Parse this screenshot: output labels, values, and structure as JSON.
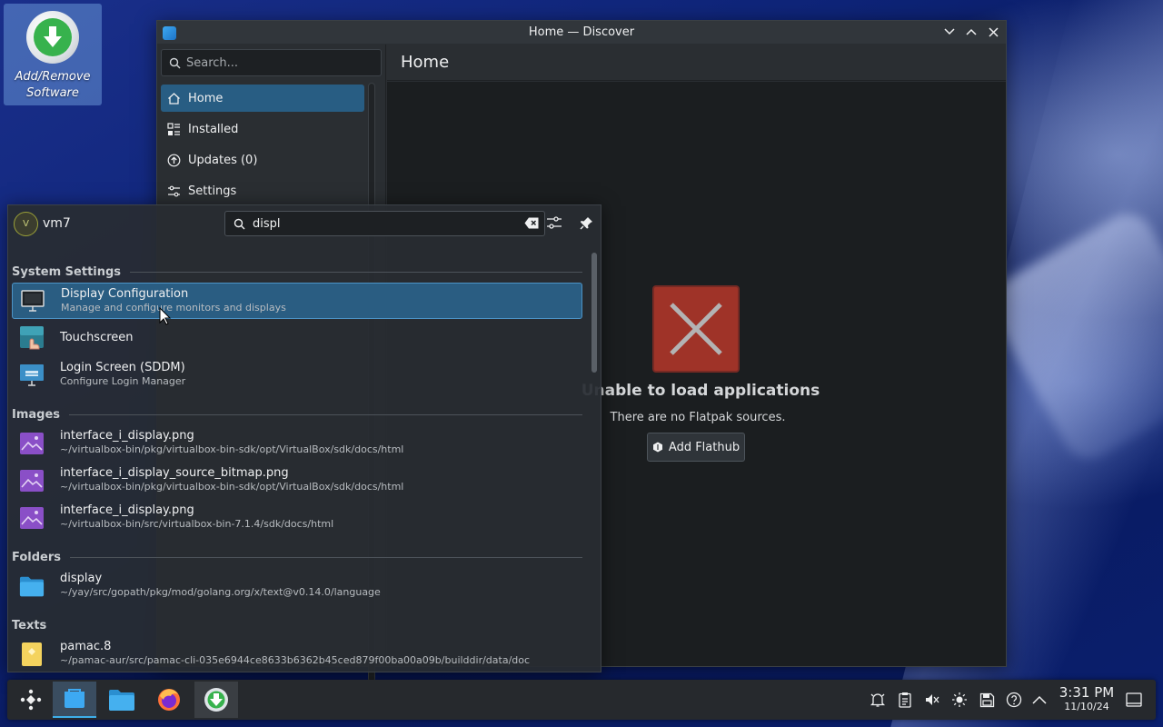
{
  "desktop": {
    "icon_label": "Add/Remove Software"
  },
  "window": {
    "title": "Home — Discover",
    "search_placeholder": "Search...",
    "nav": [
      {
        "label": "Home",
        "icon": "home-icon"
      },
      {
        "label": "Installed",
        "icon": "installed-icon"
      },
      {
        "label": "Updates (0)",
        "icon": "updates-icon"
      },
      {
        "label": "Settings",
        "icon": "settings-icon"
      }
    ],
    "page_title": "Home",
    "error_title": "Unable to load applications",
    "error_subtitle": "There are no Flatpak sources.",
    "add_flathub_label": "Add Flathub"
  },
  "launcher": {
    "username": "vm7",
    "avatar_letter": "V",
    "search_value": "displ",
    "sections": {
      "system_settings": "System Settings",
      "images": "Images",
      "folders": "Folders",
      "texts": "Texts"
    },
    "results": {
      "system_settings": [
        {
          "name": "Display Configuration",
          "sub": "Manage and configure monitors and displays"
        },
        {
          "name": "Touchscreen",
          "sub": ""
        },
        {
          "name": "Login Screen (SDDM)",
          "sub": "Configure Login Manager"
        }
      ],
      "images": [
        {
          "name": "interface_i_display.png",
          "sub": "~/virtualbox-bin/pkg/virtualbox-bin-sdk/opt/VirtualBox/sdk/docs/html"
        },
        {
          "name": "interface_i_display_source_bitmap.png",
          "sub": "~/virtualbox-bin/pkg/virtualbox-bin-sdk/opt/VirtualBox/sdk/docs/html"
        },
        {
          "name": "interface_i_display.png",
          "sub": "~/virtualbox-bin/src/virtualbox-bin-7.1.4/sdk/docs/html"
        }
      ],
      "folders": [
        {
          "name": "display",
          "sub": "~/yay/src/gopath/pkg/mod/golang.org/x/text@v0.14.0/language"
        }
      ],
      "texts": [
        {
          "name": "pamac.8",
          "sub": "~/pamac-aur/src/pamac-cli-035e6944ce8633b6362b45ced879f00ba00a09b/builddir/data/doc"
        }
      ]
    }
  },
  "taskbar": {
    "time": "3:31 PM",
    "date": "11/10/24"
  },
  "colors": {
    "accent": "#3daee9",
    "selection": "#2a5d82",
    "error": "#c0392b"
  }
}
